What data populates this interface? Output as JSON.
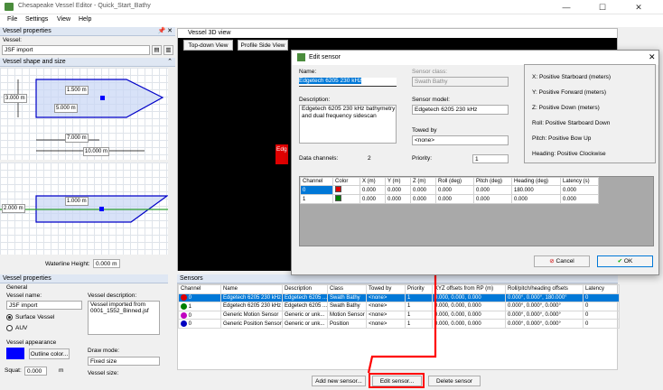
{
  "app": {
    "title": "Chesapeake Vessel Editor - Quick_Start_Bathy"
  },
  "menu": {
    "file": "File",
    "settings": "Settings",
    "view": "View",
    "help": "Help"
  },
  "window_controls": {
    "minimize": "—",
    "maximize": "☐",
    "close": "✕"
  },
  "vessel_properties_top": {
    "header": "Vessel properties",
    "pin": "📌 ✕",
    "vessel_label": "Vessel:",
    "vessel_value": "JSF import"
  },
  "shape": {
    "header": "Vessel shape and size",
    "dim1": "1.500 m",
    "dim2": "3.000 m",
    "dim3": "5.000 m",
    "dim4": "7.000 m",
    "dim5": "10.000 m",
    "dim6": "1.000 m",
    "dim7": "2.000 m",
    "waterline_label": "Waterline Height:",
    "waterline_value": "0.000 m"
  },
  "vp": {
    "header": "Vessel properties",
    "general": "General",
    "name_label": "Vessel name:",
    "name_value": "JSF import",
    "desc_label": "Vessel description:",
    "desc_value": "Vessel imported from 0001_1552_Binned.jsf",
    "surface": "Surface Vessel",
    "auv": "AUV",
    "appearance": "Vessel appearance",
    "outline_btn": "Outline color...",
    "draw_mode_label": "Draw mode:",
    "draw_mode_value": "Fixed size",
    "squat_label": "Squat:",
    "squat_value": "0.000",
    "squat_unit": "m",
    "vessel_size": "Vessel size:",
    "color": "#0000ff"
  },
  "view3d": {
    "tab": "Vessel 3D view",
    "top_down": "Top-down View",
    "profile": "Profile Side View",
    "red_label": "Edg"
  },
  "dialog": {
    "title": "Edit sensor",
    "name_label": "Name:",
    "name_value": "Edgetech 6205 230 kHz",
    "class_label": "Sensor class:",
    "class_value": "Swath Bathy",
    "desc_label": "Description:",
    "desc_value": "Edgetech 6205 230 kHz bathymetry and dual frequency sidescan",
    "model_label": "Sensor model:",
    "model_value": "Edgetech 6205 230 kHz",
    "towed_label": "Towed by",
    "towed_value": "<none>",
    "channels_label": "Data channels:",
    "channels_value": "2",
    "priority_label": "Priority:",
    "priority_value": "1",
    "info": [
      "X: Positive Starboard (meters)",
      "Y: Positive Forward (meters)",
      "Z: Positive Down (meters)",
      "Roll: Positive Starboard Down",
      "Pitch: Positive Bow Up",
      "Heading: Positive Clockwise"
    ],
    "columns": [
      "Channel",
      "Color",
      "X (m)",
      "Y (m)",
      "Z (m)",
      "Roll (deg)",
      "Pitch (deg)",
      "Heading (deg)",
      "Latency (s)"
    ],
    "rows": [
      {
        "ch": "0",
        "color": "#e00000",
        "x": "0.000",
        "y": "0.000",
        "z": "0.000",
        "roll": "0.000",
        "pitch": "0.000",
        "heading": "180.000",
        "lat": "0.000"
      },
      {
        "ch": "1",
        "color": "#008000",
        "x": "0.000",
        "y": "0.000",
        "z": "0.000",
        "roll": "0.000",
        "pitch": "0.000",
        "heading": "0.000",
        "lat": "0.000"
      }
    ],
    "cancel": "Cancel",
    "ok": "OK"
  },
  "sensors": {
    "header": "Sensors",
    "columns": [
      "Channel",
      "Name",
      "Description",
      "Class",
      "Towed by",
      "Priority",
      "XYZ offsets from RP (m)",
      "Roll/pitch/heading offsets",
      "Latency"
    ],
    "rows": [
      {
        "color": "#e00000",
        "ch": "0",
        "name": "Edgetech 6205 230 kHz",
        "desc": "Edgetech 6205 ...",
        "cls": "Swath Bathy",
        "towed": "<none>",
        "pri": "1",
        "xyz": "0.000, 0.000, 0.000",
        "rph": "0.000°, 0.000°, 180.000°",
        "lat": "0"
      },
      {
        "color": "#008000",
        "ch": "1",
        "name": "Edgetech 6205 230 kHz",
        "desc": "Edgetech 6205 ...",
        "cls": "Swath Bathy",
        "towed": "<none>",
        "pri": "1",
        "xyz": "0.000, 0.000, 0.000",
        "rph": "0.000°, 0.000°, 0.000°",
        "lat": "0"
      },
      {
        "color": "#c000c0",
        "ch": "0",
        "name": "Generic Motion Sensor",
        "desc": "Generic or unk...",
        "cls": "Motion Sensor",
        "towed": "<none>",
        "pri": "1",
        "xyz": "0.000, 0.000, 0.000",
        "rph": "0.000°, 0.000°, 0.000°",
        "lat": "0"
      },
      {
        "color": "#0000c0",
        "ch": "0",
        "name": "Generic Position Sensor",
        "desc": "Generic or unk...",
        "cls": "Position",
        "towed": "<none>",
        "pri": "1",
        "xyz": "0.000, 0.000, 0.000",
        "rph": "0.000°, 0.000°, 0.000°",
        "lat": "0"
      }
    ],
    "add": "Add new sensor...",
    "edit": "Edit sensor...",
    "delete": "Delete sensor"
  },
  "accent": "#0078d7",
  "annotation_color": "#ff0000"
}
